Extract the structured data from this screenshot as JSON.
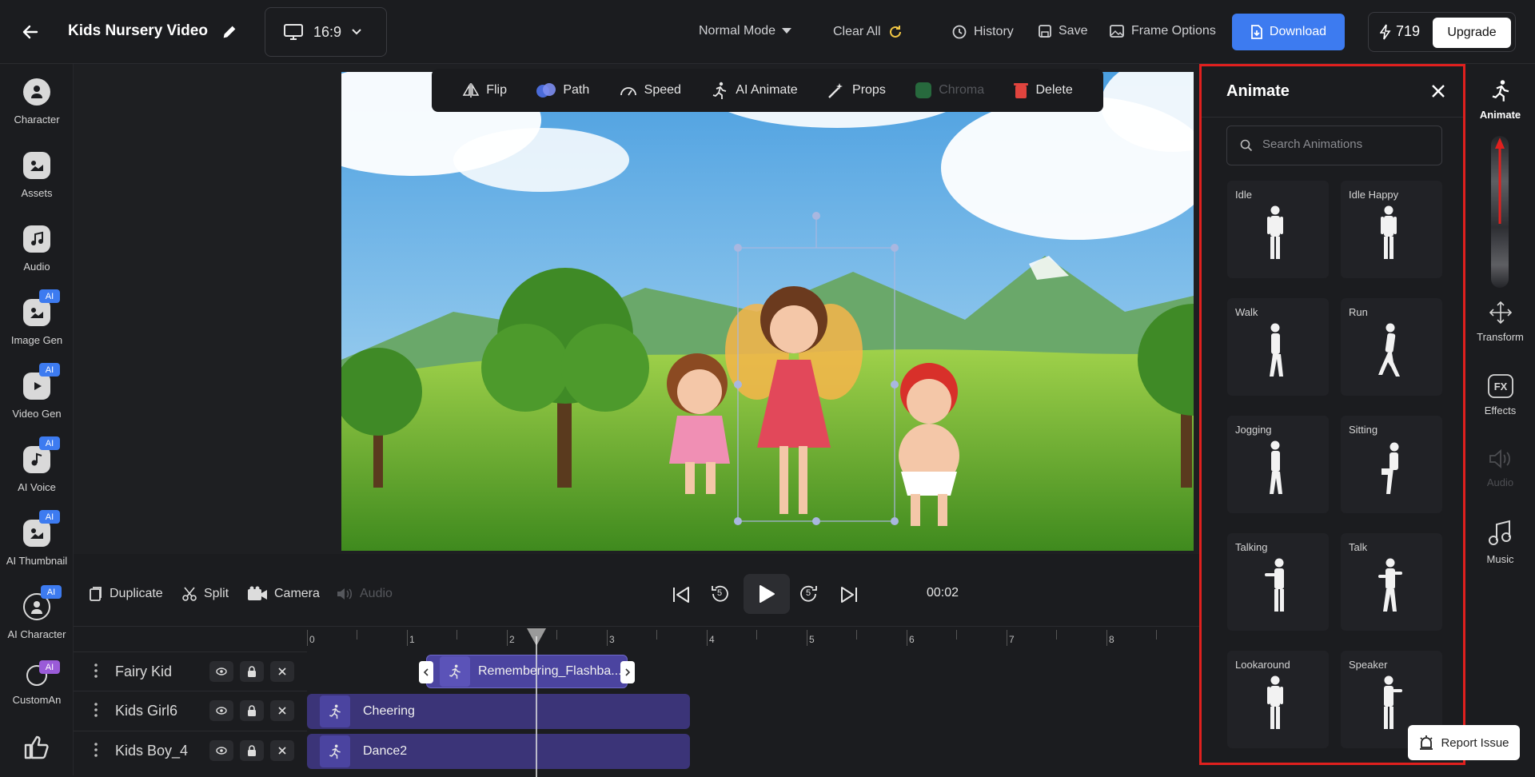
{
  "header": {
    "title": "Kids Nursery Video",
    "aspect_ratio": "16:9",
    "mode": "Normal Mode",
    "clear_all": "Clear All",
    "history": "History",
    "save": "Save",
    "frame_options": "Frame Options",
    "download": "Download",
    "credits": "719",
    "upgrade": "Upgrade"
  },
  "left_sidebar": {
    "items": [
      {
        "label": "Character",
        "icon": "character-icon"
      },
      {
        "label": "Assets",
        "icon": "assets-icon"
      },
      {
        "label": "Audio",
        "icon": "audio-icon"
      },
      {
        "label": "Image Gen",
        "icon": "image-gen-icon",
        "badge": "AI"
      },
      {
        "label": "Video Gen",
        "icon": "video-gen-icon",
        "badge": "AI"
      },
      {
        "label": "AI Voice",
        "icon": "ai-voice-icon",
        "badge": "AI"
      },
      {
        "label": "AI Thumbnail",
        "icon": "ai-thumbnail-icon",
        "badge": "AI"
      },
      {
        "label": "AI Character",
        "icon": "ai-character-icon",
        "badge": "AI"
      },
      {
        "label": "CustomAn",
        "icon": "custom-animation-icon",
        "badge": "AI"
      }
    ]
  },
  "canvas_toolbar": {
    "flip": "Flip",
    "path": "Path",
    "speed": "Speed",
    "ai_animate": "AI Animate",
    "props": "Props",
    "chroma": "Chroma",
    "delete": "Delete"
  },
  "playback": {
    "duplicate": "Duplicate",
    "split": "Split",
    "camera": "Camera",
    "audio": "Audio",
    "rewind_seconds": "5",
    "forward_seconds": "5",
    "timecode": "00:02"
  },
  "timeline": {
    "ruler": [
      "0",
      "1",
      "2",
      "3",
      "4",
      "5",
      "6",
      "7",
      "8"
    ],
    "tracks": [
      {
        "name": "Fairy Kid",
        "clip": "Remembering_Flashba..."
      },
      {
        "name": "Kids Girl6",
        "clip": "Cheering"
      },
      {
        "name": "Kids Boy_4",
        "clip": "Dance2"
      }
    ]
  },
  "animate_panel": {
    "title": "Animate",
    "search_placeholder": "Search Animations",
    "animations": [
      "Idle",
      "Idle Happy",
      "Walk",
      "Run",
      "Jogging",
      "Sitting",
      "Talking",
      "Talk",
      "Lookaround",
      "Speaker"
    ]
  },
  "right_rail": {
    "animate": "Animate",
    "transform": "Transform",
    "effects": "Effects",
    "audio": "Audio",
    "music": "Music"
  },
  "report_issue": "Report Issue",
  "colors": {
    "accent": "#3d7bf0",
    "highlight_border": "#e0201e",
    "clip_purple": "#3b3478"
  }
}
